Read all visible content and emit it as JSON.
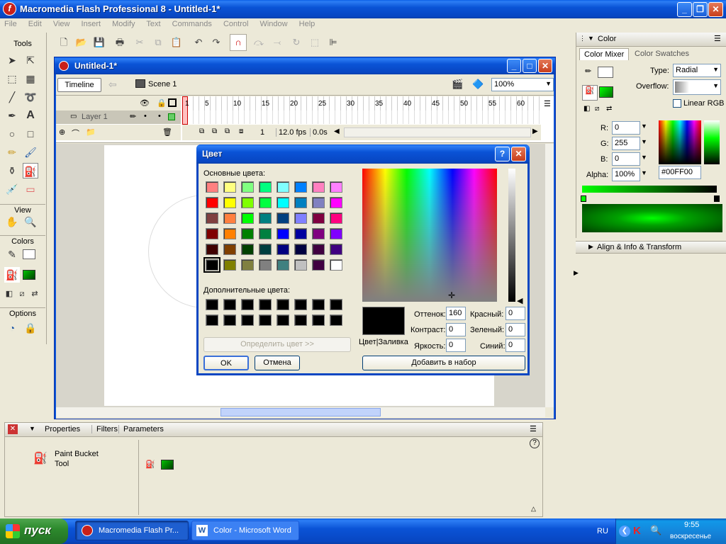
{
  "app": {
    "title": "Macromedia Flash Professional 8 - Untitled-1*",
    "menu": [
      "File",
      "Edit",
      "View",
      "Insert",
      "Modify",
      "Text",
      "Commands",
      "Control",
      "Window",
      "Help"
    ]
  },
  "tools": {
    "header": "Tools",
    "view_label": "View",
    "colors_label": "Colors",
    "options_label": "Options"
  },
  "document": {
    "title": "Untitled-1*",
    "timeline_button": "Timeline",
    "scene": "Scene 1",
    "zoom": "100%",
    "layer_name": "Layer 1",
    "frame_numbers": [
      "1",
      "5",
      "10",
      "15",
      "20",
      "25",
      "30",
      "35",
      "40",
      "45",
      "50",
      "55",
      "60"
    ],
    "current_frame": "1",
    "fps": "12.0 fps",
    "elapsed": "0.0s"
  },
  "color_panel": {
    "title": "Color",
    "tab_mixer": "Color Mixer",
    "tab_swatches": "Color Swatches",
    "type_label": "Type:",
    "type_value": "Radial",
    "overflow_label": "Overflow:",
    "linear_rgb": "Linear RGB",
    "r_label": "R:",
    "r_value": "0",
    "g_label": "G:",
    "g_value": "255",
    "b_label": "B:",
    "b_value": "0",
    "alpha_label": "Alpha:",
    "alpha_value": "100%",
    "hex_value": "#00FF00",
    "fill_color": "#00ff00",
    "align_panel": "Align & Info & Transform"
  },
  "dialog": {
    "title": "Цвет",
    "basic_label": "Основные цвета:",
    "custom_label": "Дополнительные цвета:",
    "define_button": "Определить цвет >>",
    "ok": "OK",
    "cancel": "Отмена",
    "add_button": "Добавить в набор",
    "preview_label": "Цвет|Заливка",
    "hue_label": "Оттенок:",
    "hue_value": "160",
    "sat_label": "Контраст:",
    "sat_value": "0",
    "lum_label": "Яркость:",
    "lum_value": "0",
    "red_label": "Красный:",
    "red_value": "0",
    "green_label": "Зеленый:",
    "green_value": "0",
    "blue_label": "Синий:",
    "blue_value": "0",
    "basic_colors": [
      "#ff8080",
      "#ffff80",
      "#80ff80",
      "#00ff80",
      "#80ffff",
      "#0080ff",
      "#ff80c0",
      "#ff80ff",
      "#ff0000",
      "#ffff00",
      "#80ff00",
      "#00ff40",
      "#00ffff",
      "#0080c0",
      "#8080c0",
      "#ff00ff",
      "#804040",
      "#ff8040",
      "#00ff00",
      "#008080",
      "#004080",
      "#8080ff",
      "#800040",
      "#ff0080",
      "#800000",
      "#ff8000",
      "#008000",
      "#008040",
      "#0000ff",
      "#0000a0",
      "#800080",
      "#8000ff",
      "#400000",
      "#804000",
      "#004000",
      "#004040",
      "#000080",
      "#000040",
      "#400040",
      "#400080",
      "#000000",
      "#808000",
      "#808040",
      "#808080",
      "#408080",
      "#c0c0c0",
      "#400040",
      "#ffffff"
    ]
  },
  "properties": {
    "tab_properties": "Properties",
    "tab_filters": "Filters",
    "tab_parameters": "Parameters",
    "tool_name_1": "Paint Bucket",
    "tool_name_2": "Tool"
  },
  "taskbar": {
    "start": "пуск",
    "item1": "Macromedia Flash Pr...",
    "item2": "Color - Microsoft Word",
    "lang": "RU",
    "time": "9:55",
    "day": "воскресенье"
  }
}
